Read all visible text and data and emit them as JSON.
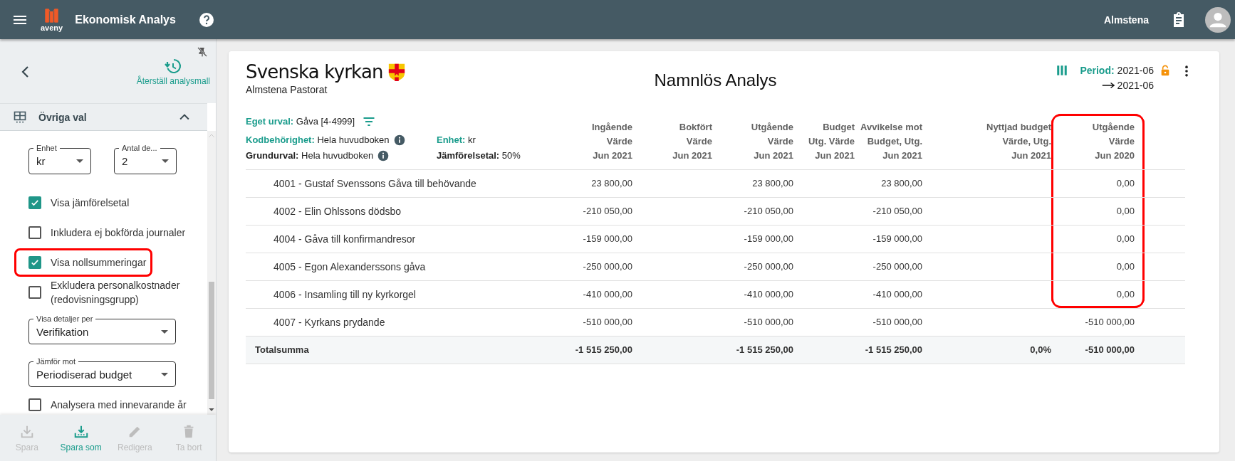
{
  "app_bar": {
    "logo_text": "aveny",
    "title": "Ekonomisk Analys",
    "user": "Almstena"
  },
  "sidebar": {
    "restore_label": "Återställ analysmall",
    "section": {
      "title": "Övriga val",
      "expanded": true
    },
    "selects_row": [
      {
        "label": "Enhet",
        "value": "kr"
      },
      {
        "label": "Antal de...",
        "value": "2"
      }
    ],
    "options": [
      {
        "kind": "checkbox",
        "label": "Visa jämförelsetal",
        "checked": true,
        "highlighted": false
      },
      {
        "kind": "checkbox",
        "label": "Inkludera ej bokförda journaler",
        "checked": false,
        "highlighted": false
      },
      {
        "kind": "checkbox",
        "label": "Visa nollsummeringar",
        "checked": true,
        "highlighted": true
      },
      {
        "kind": "checkbox",
        "label": "Exkludera personalkostnader (redovisningsgrupp)",
        "checked": false,
        "highlighted": false
      },
      {
        "kind": "select",
        "label": "Visa detaljer per",
        "value": "Verifikation"
      },
      {
        "kind": "select",
        "label": "Jämför mot",
        "value": "Periodiserad budget"
      },
      {
        "kind": "checkbox",
        "label": "Analysera med innevarande år",
        "checked": false,
        "highlighted": false
      }
    ],
    "actions": [
      {
        "kind": "save",
        "label": "Spara",
        "disabled": true
      },
      {
        "kind": "save_as",
        "label": "Spara som",
        "disabled": false
      },
      {
        "kind": "edit",
        "label": "Redigera",
        "disabled": true
      },
      {
        "kind": "delete",
        "label": "Ta bort",
        "disabled": true
      }
    ]
  },
  "report": {
    "org_name": "Svenska kyrkan",
    "unit": "Almstena Pastorat",
    "title": "Namnlös Analys",
    "period_label": "Period:",
    "period_from": "2021-06",
    "period_to": "2021-06",
    "filters": [
      [
        {
          "label": "Eget urval:",
          "value": "Gåva [4-4999]",
          "accent": true,
          "kind": "custom"
        }
      ],
      [
        {
          "label": "Kodbehörighet:",
          "value": "Hela huvudboken",
          "accent": true,
          "kind": "access"
        },
        {
          "label": "Enhet:",
          "value": "kr",
          "accent": true,
          "kind": "unit"
        }
      ],
      [
        {
          "label": "Grundurval:",
          "value": "Hela huvudboken",
          "accent": false,
          "kind": "base"
        },
        {
          "label": "Jämförelsetal:",
          "value": "50%",
          "accent": false,
          "kind": "comparison"
        }
      ]
    ],
    "columns": [
      {
        "lines": [
          "Ingående",
          "Värde",
          "Jun 2021"
        ],
        "highlighted": false
      },
      {
        "lines": [
          "Bokfört",
          "Värde",
          "Jun 2021"
        ],
        "highlighted": false
      },
      {
        "lines": [
          "Utgående",
          "Värde",
          "Jun 2021"
        ],
        "highlighted": false
      },
      {
        "lines": [
          "Budget",
          "Utg. Värde",
          "Jun 2021"
        ],
        "highlighted": false
      },
      {
        "lines": [
          "Avvikelse mot",
          "Budget, Utg.",
          "Jun 2021"
        ],
        "highlighted": false
      },
      {
        "lines": [
          "Nyttjad budget",
          "Värde, Utg.",
          "Jun 2021"
        ],
        "highlighted": false
      },
      {
        "lines": [
          "Utgående",
          "Värde",
          "Jun 2020"
        ],
        "highlighted": true
      }
    ],
    "rows": [
      {
        "kind": "account",
        "name": "4001 - Gustaf Svenssons Gåva till behövande",
        "cells": [
          "23 800,00",
          null,
          "23 800,00",
          null,
          "23 800,00",
          null,
          "0,00"
        ],
        "highlighted": true
      },
      {
        "kind": "account",
        "name": "4002 - Elin Ohlssons dödsbo",
        "cells": [
          "-210 050,00",
          null,
          "-210 050,00",
          null,
          "-210 050,00",
          null,
          "0,00"
        ],
        "highlighted": true
      },
      {
        "kind": "account",
        "name": "4004 - Gåva till konfirmandresor",
        "cells": [
          "-159 000,00",
          null,
          "-159 000,00",
          null,
          "-159 000,00",
          null,
          "0,00"
        ],
        "highlighted": true
      },
      {
        "kind": "account",
        "name": "4005 - Egon Alexanderssons gåva",
        "cells": [
          "-250 000,00",
          null,
          "-250 000,00",
          null,
          "-250 000,00",
          null,
          "0,00"
        ],
        "highlighted": true
      },
      {
        "kind": "account",
        "name": "4006 - Insamling till ny kyrkorgel",
        "cells": [
          "-410 000,00",
          null,
          "-410 000,00",
          null,
          "-410 000,00",
          null,
          "0,00"
        ],
        "highlighted": true
      },
      {
        "kind": "account",
        "name": "4007 - Kyrkans prydande",
        "cells": [
          "-510 000,00",
          null,
          "-510 000,00",
          null,
          "-510 000,00",
          null,
          "-510 000,00"
        ],
        "highlighted": false
      },
      {
        "kind": "total",
        "name": "Totalsumma",
        "cells": [
          "-1 515 250,00",
          null,
          "-1 515 250,00",
          null,
          "-1 515 250,00",
          "0,0%",
          "-510 000,00"
        ],
        "highlighted": false
      }
    ]
  }
}
